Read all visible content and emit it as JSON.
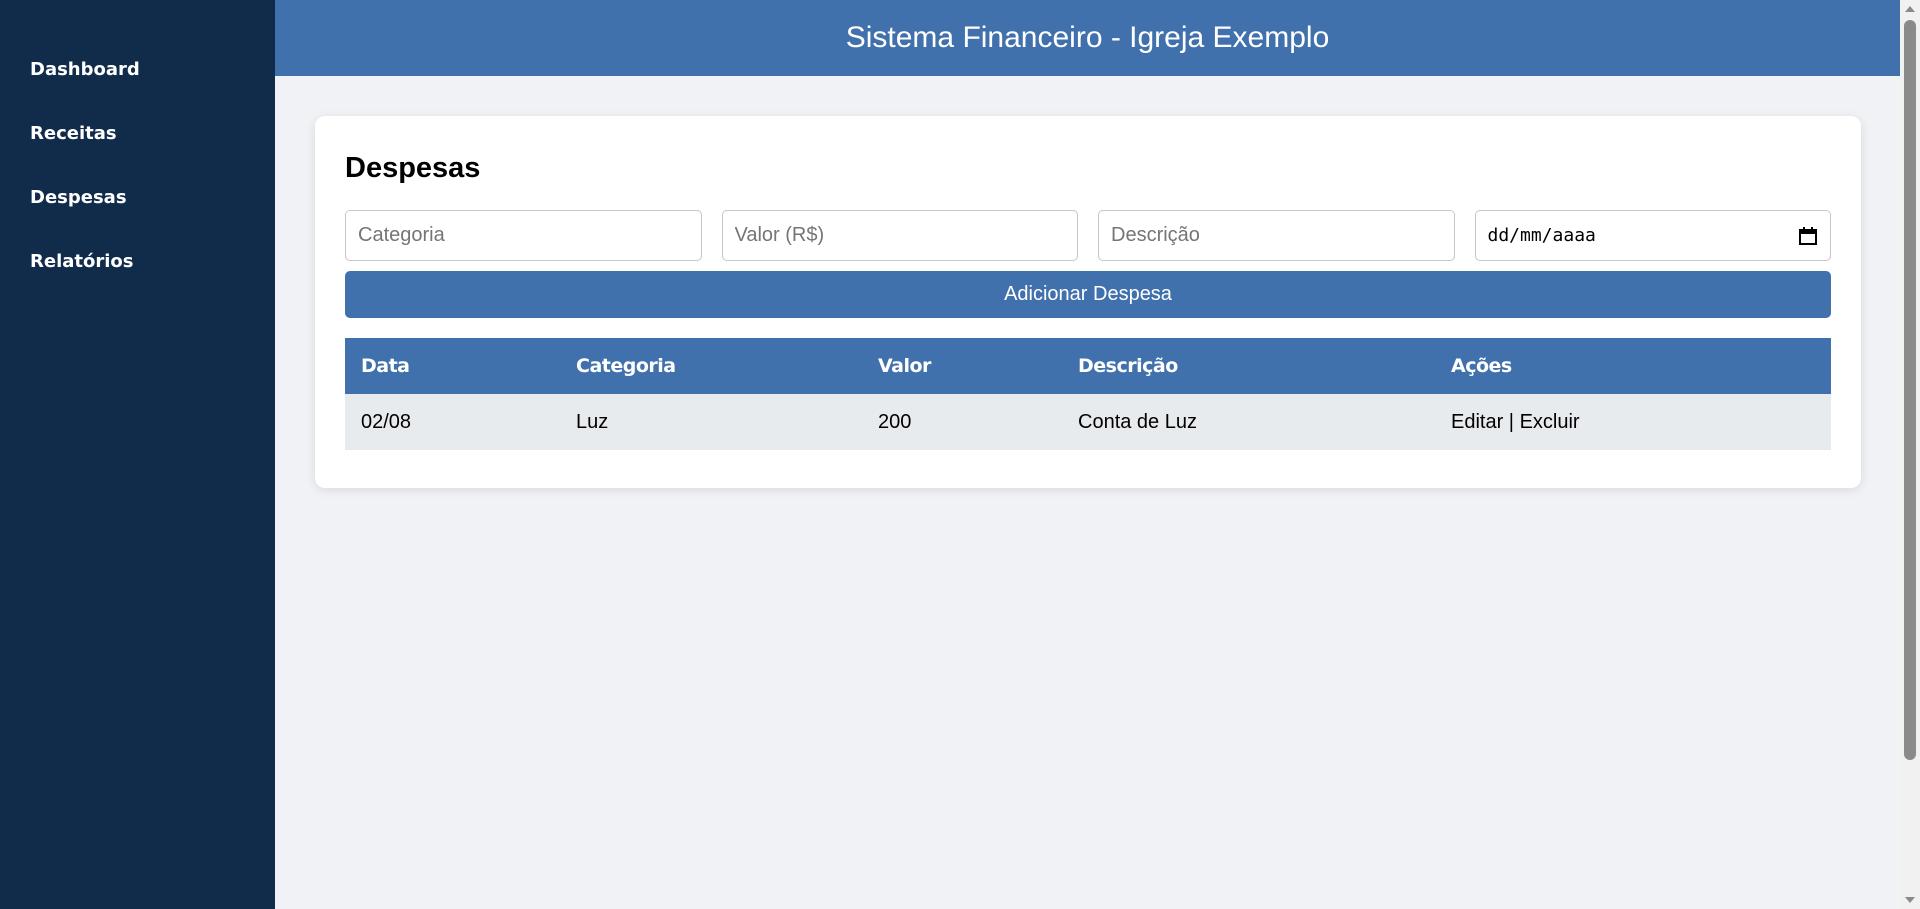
{
  "sidebar": {
    "items": [
      {
        "label": "Dashboard"
      },
      {
        "label": "Receitas"
      },
      {
        "label": "Despesas"
      },
      {
        "label": "Relatórios"
      }
    ]
  },
  "header": {
    "title": "Sistema Financeiro - Igreja Exemplo"
  },
  "main": {
    "title": "Despesas",
    "form": {
      "categoria_placeholder": "Categoria",
      "valor_placeholder": "Valor (R$)",
      "descricao_placeholder": "Descrição",
      "date_placeholder": "dd/mm/aaaa",
      "add_button_label": "Adicionar Despesa"
    },
    "table": {
      "headers": [
        "Data",
        "Categoria",
        "Valor",
        "Descrição",
        "Ações"
      ],
      "rows": [
        {
          "data": "02/08",
          "categoria": "Luz",
          "valor": "200",
          "descricao": "Conta de Luz",
          "edit": "Editar",
          "sep": " | ",
          "delete": "Excluir"
        }
      ]
    }
  },
  "colors": {
    "sidebar": "#112b4b",
    "accent": "#4171ad",
    "background": "#f0f2f5",
    "row": "#e8ebee"
  }
}
